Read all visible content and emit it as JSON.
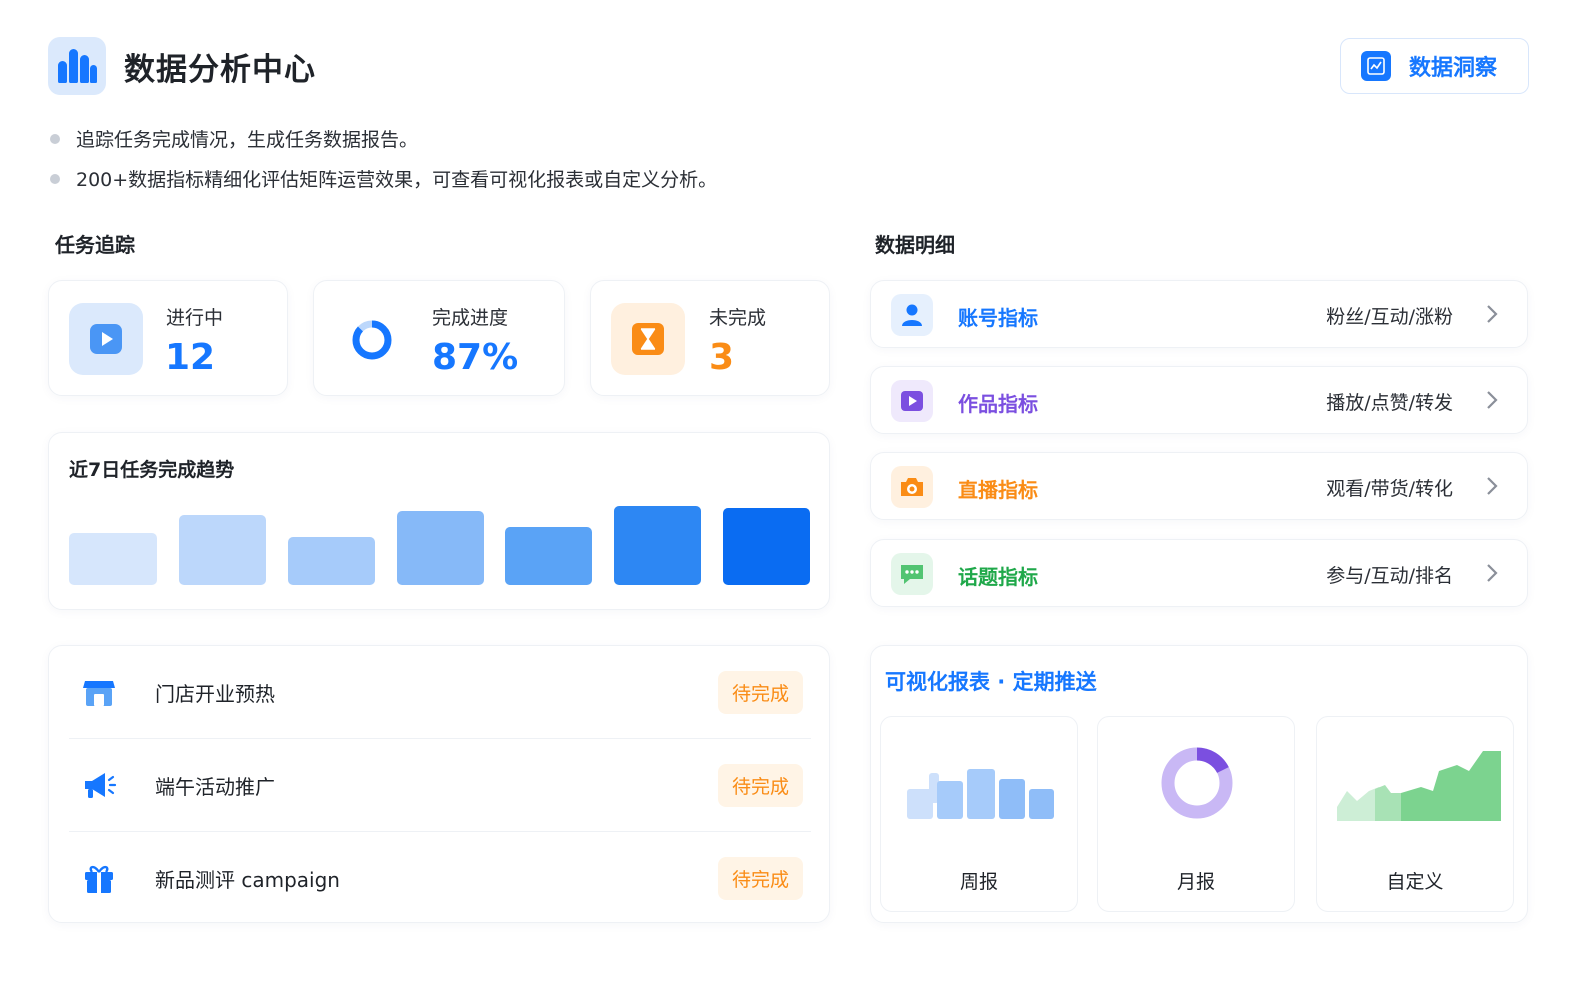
{
  "header": {
    "title": "数据分析中心",
    "insight_button": "数据洞察",
    "bullets": [
      "追踪任务完成情况，生成任务数据报告。",
      "200+数据指标精细化评估矩阵运营效果，可查看可视化报表或自定义分析。"
    ]
  },
  "task_tracking": {
    "title": "任务追踪",
    "stats": [
      {
        "label": "进行中",
        "value": "12",
        "color": "#1677ff",
        "icon": "play-icon"
      },
      {
        "label": "完成进度",
        "value": "87%",
        "progress": 0.87,
        "color": "#1677ff",
        "icon": "ring-progress-icon"
      },
      {
        "label": "未完成",
        "value": "3",
        "color": "#fa8c16",
        "icon": "hourglass-icon"
      }
    ],
    "trend": {
      "title": "近7日任务完成趋势",
      "colors": [
        "#d6e6fc",
        "#bcd7fb",
        "#a6cbfa",
        "#86b9f8",
        "#5aa3f6",
        "#2d87f3",
        "#0a6cf2"
      ]
    },
    "tasks": [
      {
        "name": "门店开业预热",
        "status": "待完成",
        "icon": "store-icon"
      },
      {
        "name": "端午活动推广",
        "status": "待完成",
        "icon": "megaphone-icon"
      },
      {
        "name": "新品测评 campaign",
        "status": "待完成",
        "icon": "gift-icon"
      }
    ]
  },
  "data_detail": {
    "title": "数据明细",
    "metrics": [
      {
        "name": "账号指标",
        "desc": "粉丝/互动/涨粉",
        "color": "#1677ff",
        "icon": "user-icon"
      },
      {
        "name": "作品指标",
        "desc": "播放/点赞/转发",
        "color": "#7b4fe0",
        "icon": "video-icon"
      },
      {
        "name": "直播指标",
        "desc": "观看/带货/转化",
        "color": "#fa8c16",
        "icon": "camera-icon"
      },
      {
        "name": "话题指标",
        "desc": "参与/互动/排名",
        "color": "#1fa84a",
        "icon": "chat-icon"
      }
    ]
  },
  "reports": {
    "title": "可视化报表 · 定期推送",
    "items": [
      {
        "label": "周报",
        "icon": "bar-chart-icon"
      },
      {
        "label": "月报",
        "icon": "donut-chart-icon"
      },
      {
        "label": "自定义",
        "icon": "area-chart-icon"
      }
    ]
  }
}
